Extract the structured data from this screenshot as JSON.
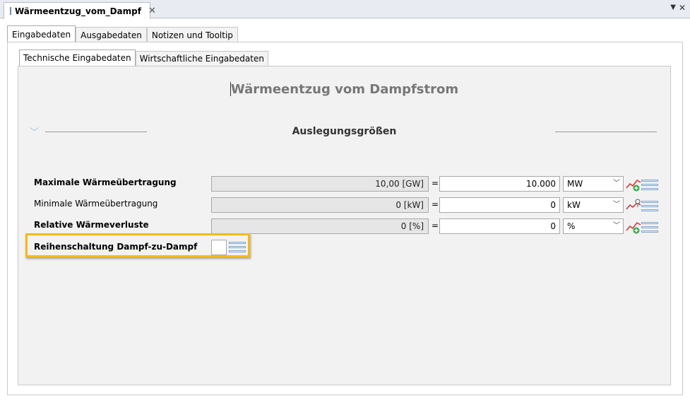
{
  "document_tab": {
    "title": "Wärmeentzug_vom_Dampf",
    "close": "✕"
  },
  "view_controls": {
    "menu": "▼",
    "close": "✕"
  },
  "main_tabs": [
    {
      "label": "Eingabedaten",
      "active": true
    },
    {
      "label": "Ausgabedaten",
      "active": false
    },
    {
      "label": "Notizen und Tooltip",
      "active": false
    }
  ],
  "sub_tabs": [
    {
      "label": "Technische Eingabedaten",
      "active": true
    },
    {
      "label": "Wirtschaftliche Eingabedaten",
      "active": false
    }
  ],
  "title": "Wärmeentzug vom Dampfstrom",
  "section": {
    "title": "Auslegungsgrößen",
    "collapse_icon": "chevron-down-icon"
  },
  "rows": [
    {
      "label": "Maximale Wärmeübertragung",
      "bold": true,
      "display": "10,00 [GW]",
      "equals": "=",
      "value": "10.000",
      "unit": "MW",
      "icon": "trend-add-icon"
    },
    {
      "label": "Minimale Wärmeübertragung",
      "bold": false,
      "display": "0 [kW]",
      "equals": "=",
      "value": "0",
      "unit": "kW",
      "icon": "trend-pin-icon"
    },
    {
      "label": "Relative Wärmeverluste",
      "bold": true,
      "display": "0 [%]",
      "equals": "=",
      "value": "0",
      "unit": "%",
      "icon": "trend-add-icon"
    }
  ],
  "checkbox_row": {
    "label": "Reihenschaltung Dampf-zu-Dampf",
    "checked": false
  },
  "colors": {
    "highlight": "#f5b91a",
    "icon_blue": "#7fa6cf",
    "trend_red": "#d23a3a",
    "plus_green": "#3aa84a"
  }
}
